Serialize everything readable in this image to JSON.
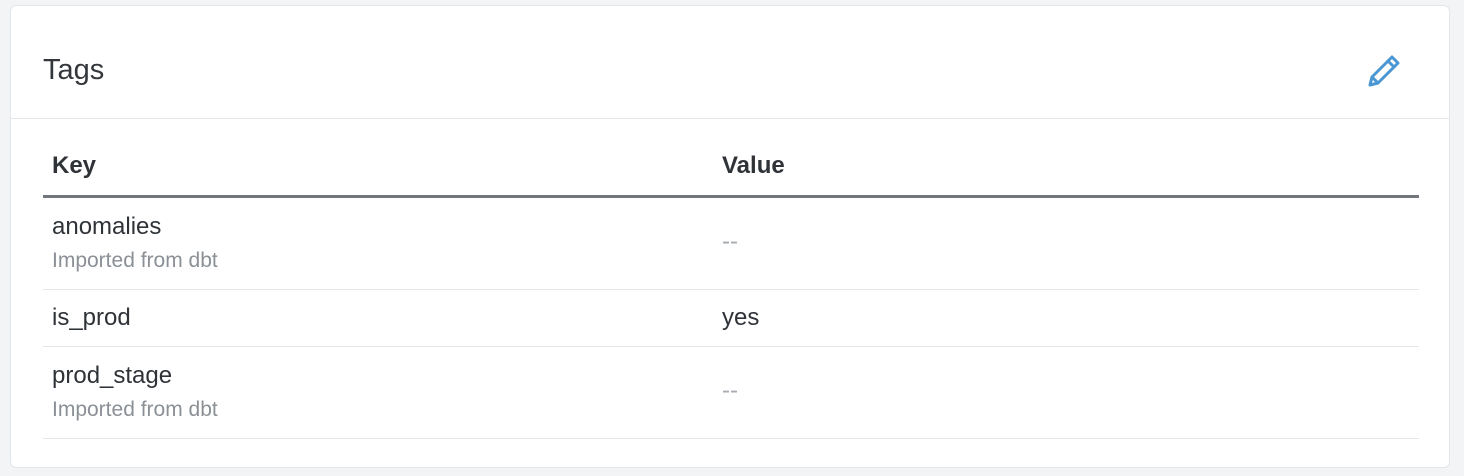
{
  "panel": {
    "title": "Tags",
    "edit_icon": "pencil-icon",
    "accent_color": "#4a97d3"
  },
  "table": {
    "headers": {
      "key": "Key",
      "value": "Value"
    },
    "rows": [
      {
        "key": "anomalies",
        "source": "Imported from dbt",
        "value": "--"
      },
      {
        "key": "is_prod",
        "source": "",
        "value": "yes"
      },
      {
        "key": "prod_stage",
        "source": "Imported from dbt",
        "value": "--"
      }
    ]
  }
}
